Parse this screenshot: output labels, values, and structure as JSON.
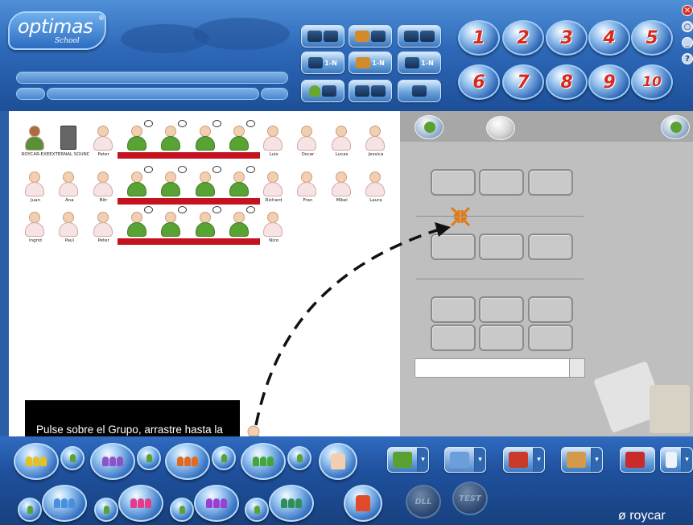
{
  "header": {
    "logo": {
      "title": "optimas",
      "subtitle": "School",
      "reg": "®"
    },
    "toolbar_buttons": [
      {
        "icon": "monitor-film-icon"
      },
      {
        "icon": "monitor-film-icon"
      },
      {
        "icon": "monitor-film-icon"
      },
      {
        "icon": "cd-copy-icon",
        "label": "1-N"
      },
      {
        "icon": "folder-copy-icon",
        "label": "1-N"
      },
      {
        "icon": "tools-copy-icon",
        "label": "1-N"
      },
      {
        "icon": "student-monitor-icon"
      },
      {
        "icon": "teacher-monitor-icon"
      },
      {
        "icon": "remote-control-icon"
      }
    ],
    "numbered_buttons": [
      "1",
      "2",
      "3",
      "4",
      "5",
      "6",
      "7",
      "8",
      "9",
      "10"
    ],
    "side_buttons": [
      "✕",
      "○",
      "_",
      "?"
    ]
  },
  "students": {
    "row1": [
      {
        "name": "ROYCAR-EXE",
        "type": "teacher"
      },
      {
        "name": "EXTERNAL SOUND",
        "type": "tower"
      },
      {
        "name": "Peter",
        "type": "idle"
      },
      {
        "name": "",
        "type": "active"
      },
      {
        "name": "",
        "type": "active"
      },
      {
        "name": "",
        "type": "active"
      },
      {
        "name": "",
        "type": "active"
      },
      {
        "name": "Luis",
        "type": "idle"
      },
      {
        "name": "Oscar",
        "type": "idle"
      },
      {
        "name": "Lucas",
        "type": "idle"
      },
      {
        "name": "Jessica",
        "type": "idle"
      }
    ],
    "row2": [
      {
        "name": "Juan",
        "type": "idle"
      },
      {
        "name": "Ana",
        "type": "idle"
      },
      {
        "name": "Bitr",
        "type": "idle"
      },
      {
        "name": "",
        "type": "active"
      },
      {
        "name": "",
        "type": "active"
      },
      {
        "name": "",
        "type": "active"
      },
      {
        "name": "",
        "type": "active"
      },
      {
        "name": "Richard",
        "type": "idle"
      },
      {
        "name": "Fran",
        "type": "idle"
      },
      {
        "name": "Mikel",
        "type": "idle"
      },
      {
        "name": "Laura",
        "type": "idle"
      }
    ],
    "row3": [
      {
        "name": "Ingrid",
        "type": "idle"
      },
      {
        "name": "Paul",
        "type": "idle"
      },
      {
        "name": "Peter",
        "type": "idle"
      },
      {
        "name": "",
        "type": "active"
      },
      {
        "name": "",
        "type": "active"
      },
      {
        "name": "",
        "type": "active"
      },
      {
        "name": "",
        "type": "active"
      },
      {
        "name": "Nico",
        "type": "idle"
      }
    ]
  },
  "instruction": {
    "text": "Pulse sobre el Grupo, arrastre hasta la zona de la pantalla en gris y suelte el botón del ratón"
  },
  "right_panel": {
    "input_value": ""
  },
  "bottom_bar": {
    "group_colors_top": [
      "#e6c020",
      "#8f52c6",
      "#e06a1f",
      "#43a637"
    ],
    "group_colors_bottom": [
      "#4a8ee0",
      "#e63a8a",
      "#9a3fd0",
      "#2f8f5b"
    ],
    "round_labels": [
      "DLL",
      "TEST"
    ],
    "dropdown_glyph": "▾",
    "brand": "ø roycar"
  },
  "colors": {
    "active_name": "#c4121f",
    "panel_gray": "#bfbfbf",
    "header_blue": "#2d68b8"
  }
}
